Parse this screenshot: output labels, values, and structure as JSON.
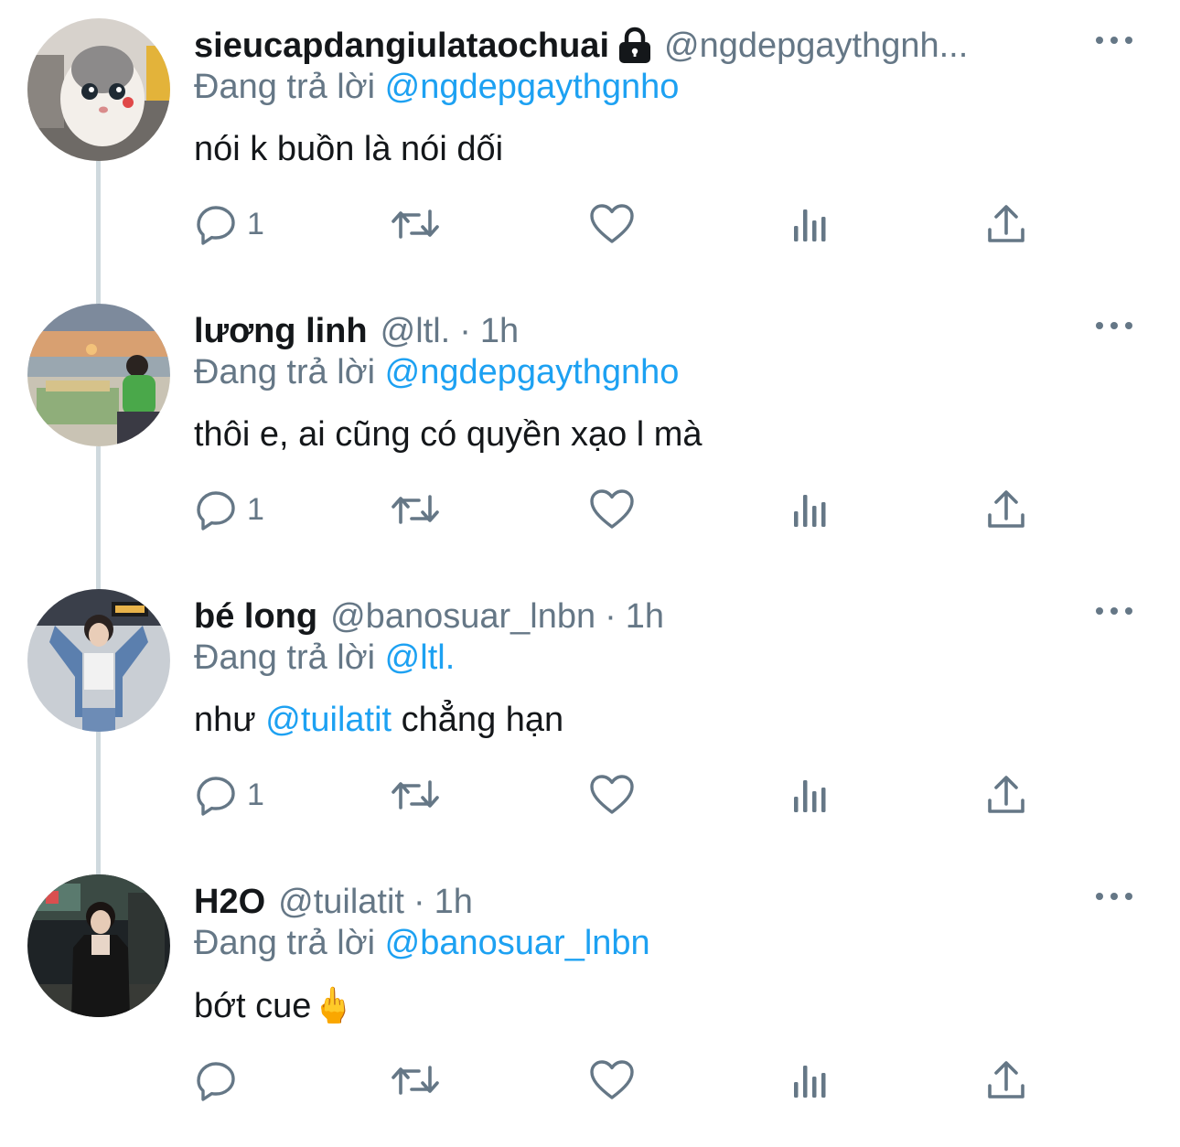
{
  "colors": {
    "link": "#1da1f2",
    "muted": "#657786",
    "text": "#14171a",
    "thread_line": "#cfd9de"
  },
  "replying_prefix": "Đang trả lời",
  "tweets": [
    {
      "name": "sieucapdangiulataochuai",
      "locked": true,
      "handle": "@ngdepgaythgnh...",
      "time": "",
      "replying_to": "@ngdepgaythgnho",
      "text_parts": [
        {
          "text": "nói k buồn là nói dối",
          "mention": false
        }
      ],
      "reply_count": "1",
      "avatar": "cat-photo"
    },
    {
      "name": "lương linh",
      "locked": false,
      "handle": "@ltl.",
      "time": "1h",
      "replying_to": "@ngdepgaythgnho",
      "text_parts": [
        {
          "text": "thôi e, ai cũng có quyền xạo l mà",
          "mention": false
        }
      ],
      "reply_count": "1",
      "avatar": "beach-sunset-photo"
    },
    {
      "name": "bé long",
      "locked": false,
      "handle": "@banosuar_lnbn",
      "time": "1h",
      "replying_to": "@ltl.",
      "text_parts": [
        {
          "text": "như ",
          "mention": false
        },
        {
          "text": "@tuilatit",
          "mention": true
        },
        {
          "text": " chẳng hạn",
          "mention": false
        }
      ],
      "reply_count": "1",
      "avatar": "denim-jacket-photo"
    },
    {
      "name": "H2O",
      "locked": false,
      "handle": "@tuilatit",
      "time": "1h",
      "replying_to": "@banosuar_lnbn",
      "text_parts": [
        {
          "text": "bớt cue",
          "mention": false
        },
        {
          "text": "🖕",
          "mention": false
        }
      ],
      "reply_count": "",
      "avatar": "night-street-photo"
    }
  ],
  "icons": {
    "reply": "reply-icon",
    "retweet": "retweet-icon",
    "like": "heart-icon",
    "analytics": "analytics-icon",
    "share": "share-icon",
    "more": "more-icon",
    "lock": "lock-icon"
  }
}
